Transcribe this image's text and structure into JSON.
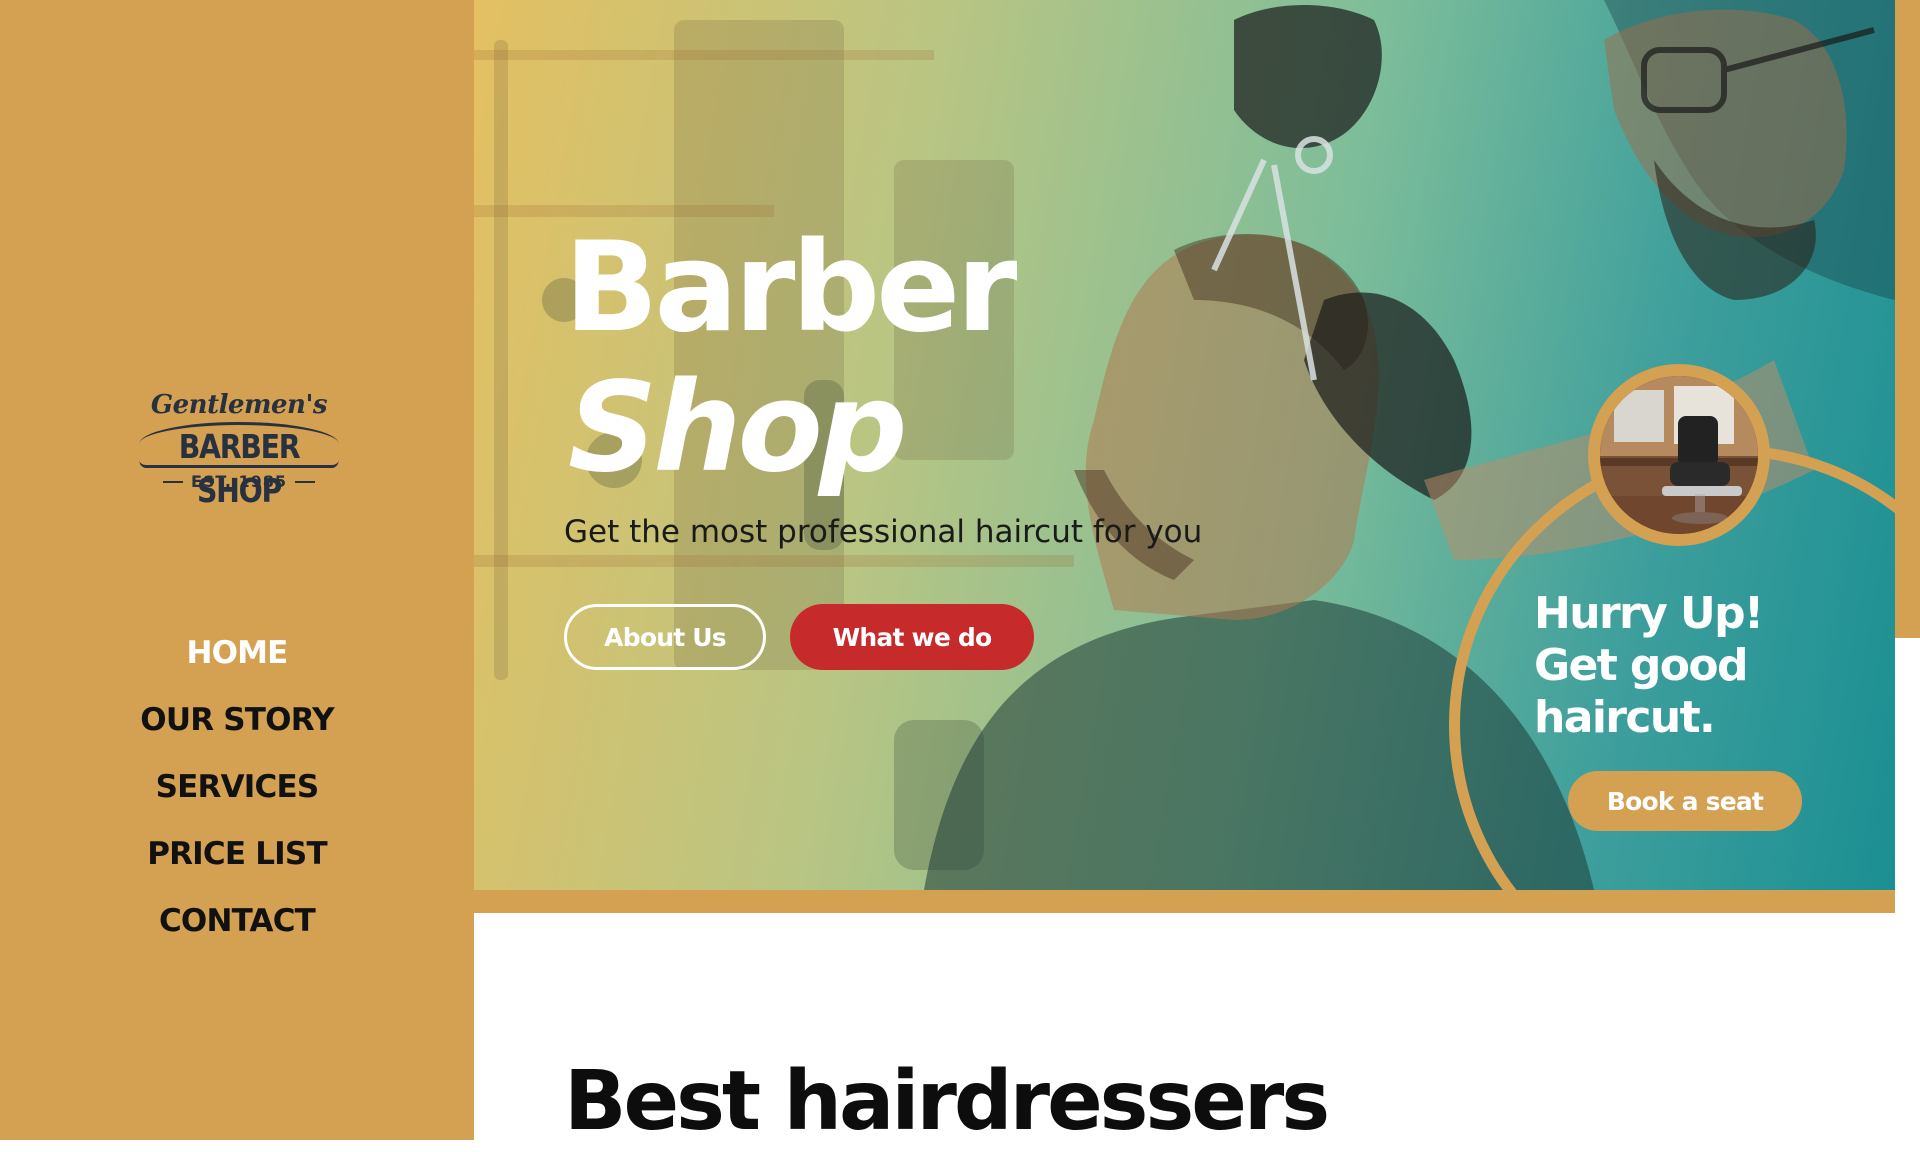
{
  "brand": {
    "script": "Gentlemen's",
    "name": "BARBER SHOP",
    "established": "EST. 1985"
  },
  "nav": {
    "items": [
      {
        "label": "HOME",
        "active": true
      },
      {
        "label": "OUR STORY",
        "active": false
      },
      {
        "label": "SERVICES",
        "active": false
      },
      {
        "label": "PRICE LIST",
        "active": false
      },
      {
        "label": "CONTACT",
        "active": false
      }
    ]
  },
  "hero": {
    "title_line1": "Barber",
    "title_line2": "Shop",
    "subtitle": "Get the most professional haircut for you",
    "about_button": "About Us",
    "what_button": "What we do"
  },
  "promo": {
    "heading_line1": "Hurry Up!",
    "heading_line2": "Get good",
    "heading_line3": "haircut.",
    "book_button": "Book a seat"
  },
  "section": {
    "title": "Best hairdressers"
  },
  "colors": {
    "sidebar": "#d4a052",
    "accent_red": "#c62a2a",
    "teal": "#1b8f93",
    "logo_ink": "#27313f"
  }
}
